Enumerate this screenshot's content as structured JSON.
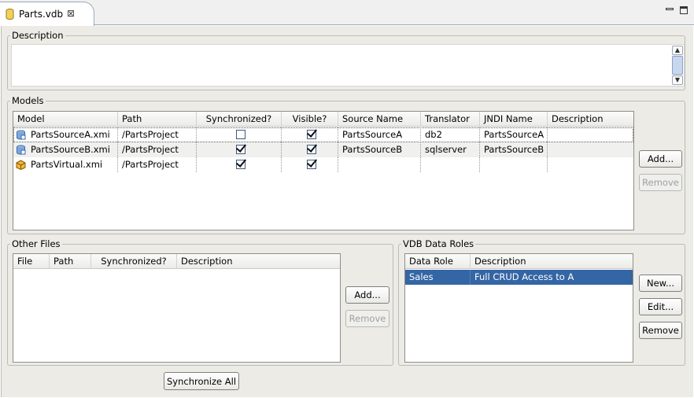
{
  "editor_tab": {
    "title": "Parts.vdb",
    "close_glyph": "⊠"
  },
  "colors": {
    "selection": "#3465a4",
    "panel": "#ecebe6",
    "header": "#ebebe8"
  },
  "description": {
    "label": "Description",
    "value": ""
  },
  "models": {
    "label": "Models",
    "columns": [
      "Model",
      "Path",
      "Synchronized?",
      "Visible?",
      "Source Name",
      "Translator",
      "JNDI Name",
      "Description"
    ],
    "rows": [
      {
        "icon": "source-model-icon",
        "model": "PartsSourceA.xmi",
        "path": "/PartsProject",
        "synchronized": false,
        "visible": true,
        "source_name": "PartsSourceA",
        "translator": "db2",
        "jndi_name": "PartsSourceA",
        "description": ""
      },
      {
        "icon": "source-model-icon",
        "model": "PartsSourceB.xmi",
        "path": "/PartsProject",
        "synchronized": true,
        "visible": true,
        "source_name": "PartsSourceB",
        "translator": "sqlserver",
        "jndi_name": "PartsSourceB",
        "description": ""
      },
      {
        "icon": "virtual-model-icon",
        "model": "PartsVirtual.xmi",
        "path": "/PartsProject",
        "synchronized": true,
        "visible": true,
        "source_name": "",
        "translator": "",
        "jndi_name": "",
        "description": ""
      }
    ],
    "add_label": "Add...",
    "remove_label": "Remove"
  },
  "other_files": {
    "label": "Other Files",
    "columns": [
      "File",
      "Path",
      "Synchronized?",
      "Description"
    ],
    "add_label": "Add...",
    "remove_label": "Remove"
  },
  "data_roles": {
    "label": "VDB Data Roles",
    "columns": [
      "Data Role",
      "Description"
    ],
    "rows": [
      {
        "role": "Sales",
        "description": "Full CRUD Access to A"
      }
    ],
    "new_label": "New...",
    "edit_label": "Edit...",
    "remove_label": "Remove"
  },
  "synchronize_all_label": "Synchronize All"
}
